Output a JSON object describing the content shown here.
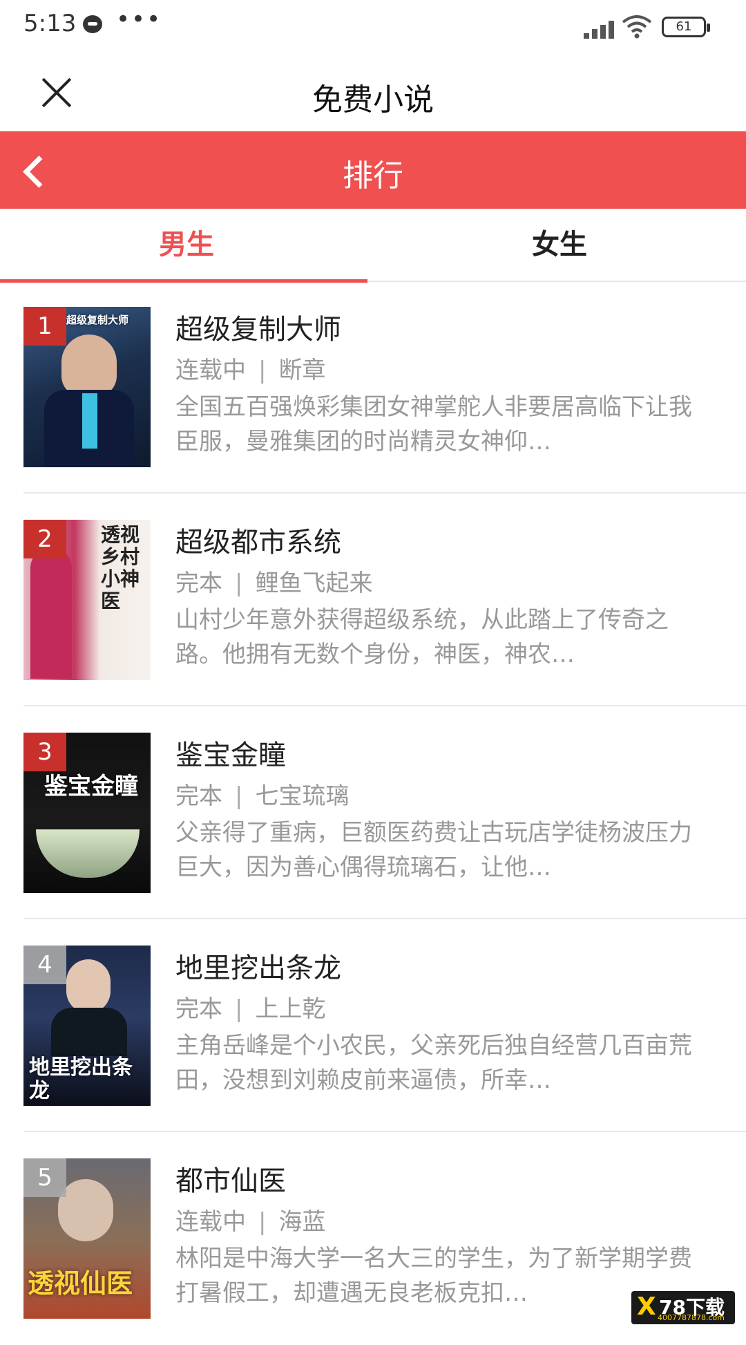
{
  "status_bar": {
    "time": "5:13",
    "dots": "•••",
    "battery": "61"
  },
  "title_bar": {
    "title": "免费小说"
  },
  "header": {
    "title": "排行"
  },
  "tabs": [
    {
      "label": "男生",
      "active": true
    },
    {
      "label": "女生",
      "active": false
    }
  ],
  "books": [
    {
      "rank": "1",
      "title": "超级复制大师",
      "status": "连载中",
      "author": "断章",
      "desc": "全国五百强焕彩集团女神掌舵人非要居高临下让我臣服，曼雅集团的时尚精灵女神仰…",
      "cover_text": "超级复制大师"
    },
    {
      "rank": "2",
      "title": "超级都市系统",
      "status": "完本",
      "author": "鲤鱼飞起来",
      "desc": "山村少年意外获得超级系统，从此踏上了传奇之路。他拥有无数个身份，神医，神农…",
      "cover_text": "透视乡村小神医"
    },
    {
      "rank": "3",
      "title": "鉴宝金瞳",
      "status": "完本",
      "author": "七宝琉璃",
      "desc": "父亲得了重病，巨额医药费让古玩店学徒杨波压力巨大，因为善心偶得琉璃石，让他…",
      "cover_text": "鉴宝金瞳"
    },
    {
      "rank": "4",
      "title": "地里挖出条龙",
      "status": "完本",
      "author": "上上乾",
      "desc": "主角岳峰是个小农民，父亲死后独自经营几百亩荒田，没想到刘赖皮前来逼债，所幸…",
      "cover_text": "地里挖出条龙"
    },
    {
      "rank": "5",
      "title": "都市仙医",
      "status": "连载中",
      "author": "海蓝",
      "desc": "林阳是中海大学一名大三的学生，为了新学期学费打暑假工，却遭遇无良老板克扣…",
      "cover_text": "透视仙医"
    }
  ],
  "watermark": {
    "logo": "X",
    "text": "78下载",
    "url": "4007787878.com"
  },
  "colors": {
    "accent": "#f05050",
    "rank_top": "#c8302c",
    "rank_low": "#aaaaaa"
  }
}
